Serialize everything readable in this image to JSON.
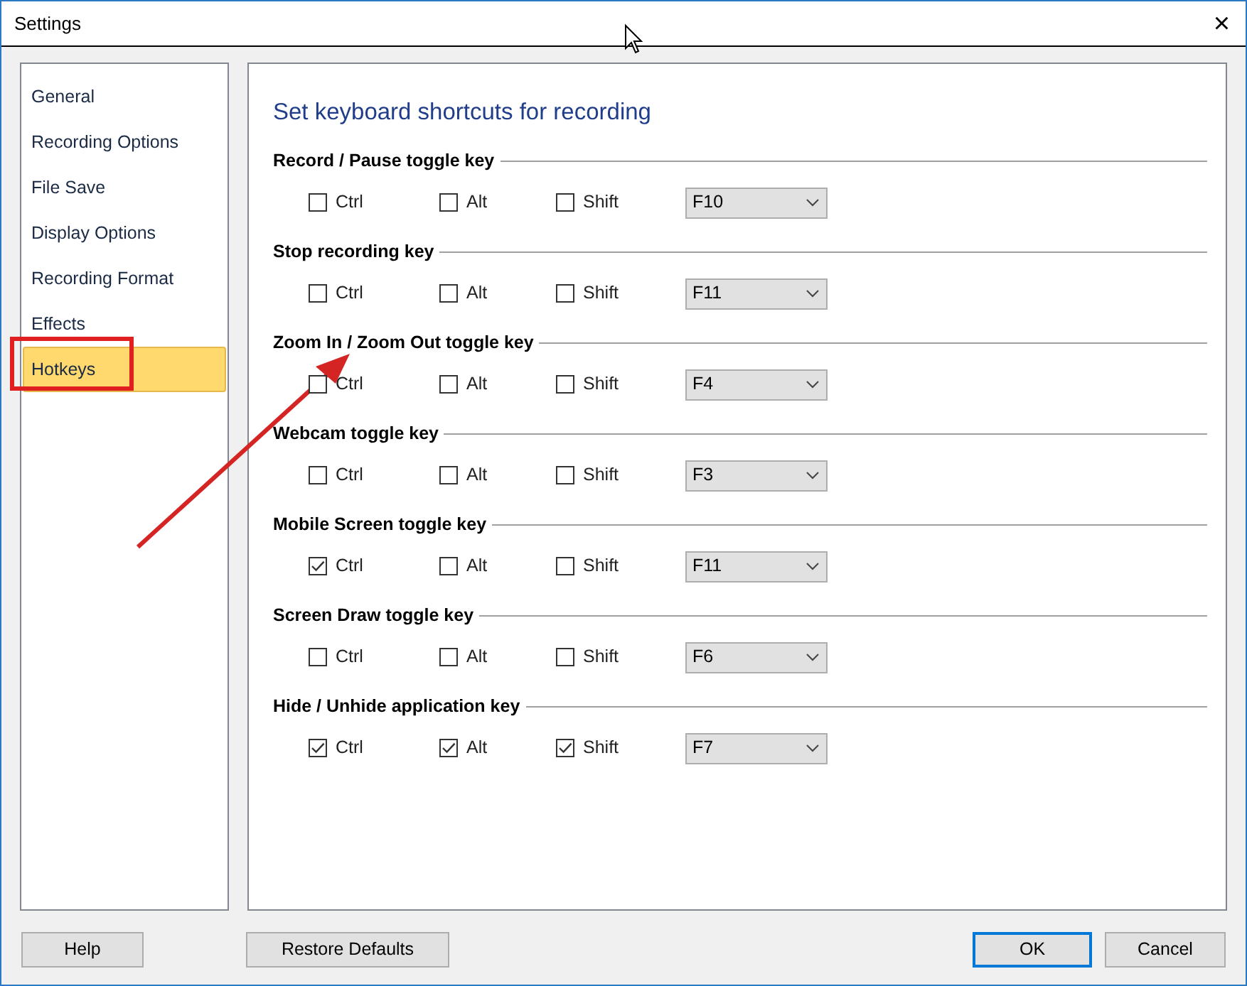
{
  "window": {
    "title": "Settings",
    "close": "×"
  },
  "sidebar": {
    "items": [
      {
        "label": "General",
        "selected": false
      },
      {
        "label": "Recording Options",
        "selected": false
      },
      {
        "label": "File Save",
        "selected": false
      },
      {
        "label": "Display Options",
        "selected": false
      },
      {
        "label": "Recording Format",
        "selected": false
      },
      {
        "label": "Effects",
        "selected": false
      },
      {
        "label": "Hotkeys",
        "selected": true
      }
    ]
  },
  "heading": "Set keyboard shortcuts for recording",
  "groups": [
    {
      "title": "Record / Pause toggle key",
      "modifiers": [
        {
          "label": "Ctrl",
          "checked": false
        },
        {
          "label": "Alt",
          "checked": false
        },
        {
          "label": "Shift",
          "checked": false
        }
      ],
      "key": "F10"
    },
    {
      "title": "Stop recording key",
      "modifiers": [
        {
          "label": "Ctrl",
          "checked": false
        },
        {
          "label": "Alt",
          "checked": false
        },
        {
          "label": "Shift",
          "checked": false
        }
      ],
      "key": "F11"
    },
    {
      "title": "Zoom In / Zoom Out toggle key",
      "modifiers": [
        {
          "label": "Ctrl",
          "checked": false
        },
        {
          "label": "Alt",
          "checked": false
        },
        {
          "label": "Shift",
          "checked": false
        }
      ],
      "key": "F4"
    },
    {
      "title": "Webcam toggle key",
      "modifiers": [
        {
          "label": "Ctrl",
          "checked": false
        },
        {
          "label": "Alt",
          "checked": false
        },
        {
          "label": "Shift",
          "checked": false
        }
      ],
      "key": "F3"
    },
    {
      "title": "Mobile Screen toggle key",
      "modifiers": [
        {
          "label": "Ctrl",
          "checked": true
        },
        {
          "label": "Alt",
          "checked": false
        },
        {
          "label": "Shift",
          "checked": false
        }
      ],
      "key": "F11"
    },
    {
      "title": "Screen Draw toggle key",
      "modifiers": [
        {
          "label": "Ctrl",
          "checked": false
        },
        {
          "label": "Alt",
          "checked": false
        },
        {
          "label": "Shift",
          "checked": false
        }
      ],
      "key": "F6"
    },
    {
      "title": "Hide / Unhide application key",
      "modifiers": [
        {
          "label": "Ctrl",
          "checked": true
        },
        {
          "label": "Alt",
          "checked": true
        },
        {
          "label": "Shift",
          "checked": true
        }
      ],
      "key": "F7"
    }
  ],
  "buttons": [
    {
      "label": "Help",
      "default": false
    },
    {
      "label": "Restore Defaults",
      "default": false
    },
    {
      "label": "OK",
      "default": true
    },
    {
      "label": "Cancel",
      "default": false
    }
  ]
}
